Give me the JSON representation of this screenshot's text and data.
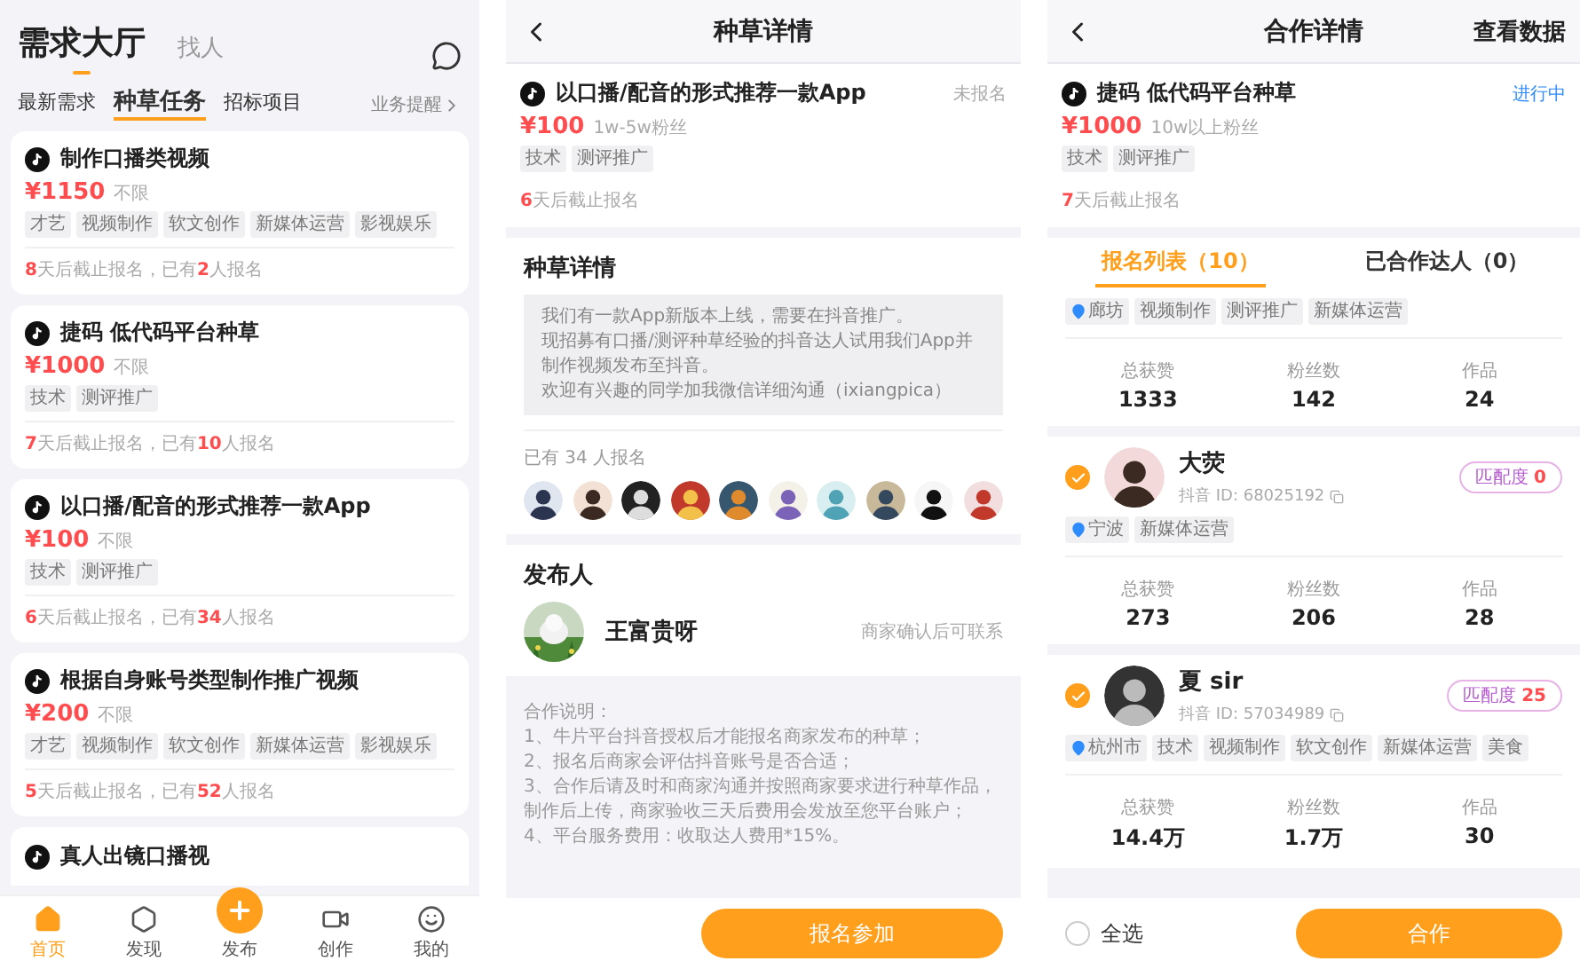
{
  "hall_screen": {
    "header_tabs": [
      {
        "label": "需求大厅",
        "selected": true
      },
      {
        "label": "找人",
        "selected": false
      }
    ],
    "sub_tabs": [
      {
        "label": "最新需求",
        "selected": false
      },
      {
        "label": "种草任务",
        "selected": true
      },
      {
        "label": "招标项目",
        "selected": false
      }
    ],
    "reminder_link": "业务提醒",
    "tasks": [
      {
        "title": "制作口播类视频",
        "price": "¥1150",
        "audience": "不限",
        "tags": [
          "才艺",
          "视频制作",
          "软文创作",
          "新媒体运营",
          "影视娱乐"
        ],
        "footer": [
          {
            "text": "8",
            "highlight": true
          },
          {
            "text": "天后截止报名，已有",
            "highlight": false
          },
          {
            "text": "2",
            "highlight": true
          },
          {
            "text": "人报名",
            "highlight": false
          }
        ]
      },
      {
        "title": "捷码 低代码平台种草",
        "price": "¥1000",
        "audience": "不限",
        "tags": [
          "技术",
          "测评推广"
        ],
        "footer": [
          {
            "text": "7",
            "highlight": true
          },
          {
            "text": "天后截止报名，已有",
            "highlight": false
          },
          {
            "text": "10",
            "highlight": true
          },
          {
            "text": "人报名",
            "highlight": false
          }
        ]
      },
      {
        "title": "以口播/配音的形式推荐一款App",
        "price": "¥100",
        "audience": "不限",
        "tags": [
          "技术",
          "测评推广"
        ],
        "footer": [
          {
            "text": "6",
            "highlight": true
          },
          {
            "text": "天后截止报名，已有",
            "highlight": false
          },
          {
            "text": "34",
            "highlight": true
          },
          {
            "text": "人报名",
            "highlight": false
          }
        ]
      },
      {
        "title": "根据自身账号类型制作推广视频",
        "price": "¥200",
        "audience": "不限",
        "tags": [
          "才艺",
          "视频制作",
          "软文创作",
          "新媒体运营",
          "影视娱乐"
        ],
        "footer": [
          {
            "text": "5",
            "highlight": true
          },
          {
            "text": "天后截止报名，已有",
            "highlight": false
          },
          {
            "text": "52",
            "highlight": true
          },
          {
            "text": "人报名",
            "highlight": false
          }
        ]
      }
    ],
    "partial_task": {
      "title": "真人出镜口播视"
    },
    "nav": [
      {
        "label": "首页",
        "kind": "home",
        "selected": true
      },
      {
        "label": "发现",
        "kind": "discover",
        "selected": false
      },
      {
        "label": "发布",
        "kind": "publish",
        "selected": false
      },
      {
        "label": "创作",
        "kind": "create",
        "selected": false
      },
      {
        "label": "我的",
        "kind": "me",
        "selected": false
      }
    ]
  },
  "detail_screen": {
    "title": "种草详情",
    "task": {
      "title": "以口播/配音的形式推荐一款App",
      "status": {
        "text": "未报名",
        "kind": "pending"
      },
      "price": "¥100",
      "audience": "1w-5w粉丝",
      "tags": [
        "技术",
        "测评推广"
      ],
      "deadline": [
        {
          "text": "6",
          "highlight": true
        },
        {
          "text": "天后截止报名",
          "highlight": false
        }
      ]
    },
    "description": {
      "heading": "种草详情",
      "lines": [
        "我们有一款App新版本上线，需要在抖音推广。",
        "现招募有口播/测评种草经验的抖音达人试用我们App并",
        "制作视频发布至抖音。",
        "欢迎有兴趣的同学加我微信详细沟通（ixiangpica）"
      ]
    },
    "signup_count": "已有 34 人报名",
    "avatars": [
      {
        "kind": "avatar"
      },
      {
        "kind": "avatar"
      },
      {
        "kind": "avatar"
      },
      {
        "kind": "avatar"
      },
      {
        "kind": "avatar"
      },
      {
        "kind": "avatar"
      },
      {
        "kind": "avatar"
      },
      {
        "kind": "avatar"
      },
      {
        "kind": "avatar"
      },
      {
        "kind": "avatar"
      }
    ],
    "publisher": {
      "heading": "发布人",
      "name": "王富贵呀",
      "note": "商家确认后可联系"
    },
    "notes": [
      "合作说明：",
      "1、牛片平台抖音授权后才能报名商家发布的种草；",
      "2、报名后商家会评估抖音账号是否合适；",
      "3、合作后请及时和商家沟通并按照商家要求进行种草作品，制作后上传，商家验收三天后费用会发放至您平台账户；",
      "4、平台服务费用：收取达人费用*15%。"
    ],
    "join_button": "报名参加"
  },
  "cooperation_screen": {
    "title": "合作详情",
    "action": "查看数据",
    "task": {
      "title": "捷码 低代码平台种草",
      "status": {
        "text": "进行中",
        "kind": "active"
      },
      "price": "¥1000",
      "audience": "10w以上粉丝",
      "tags": [
        "技术",
        "测评推广"
      ],
      "deadline": [
        {
          "text": "7",
          "highlight": true
        },
        {
          "text": "天后截止报名",
          "highlight": false
        }
      ]
    },
    "tabs": [
      {
        "label": "报名列表（10）",
        "selected": true
      },
      {
        "label": "已合作达人（0）",
        "selected": false
      }
    ],
    "partial_creator": {
      "tags": [
        {
          "text": "廊坊",
          "kind": "location"
        },
        {
          "text": "视频制作",
          "kind": "tag"
        },
        {
          "text": "测评推广",
          "kind": "tag"
        },
        {
          "text": "新媒体运营",
          "kind": "tag"
        }
      ],
      "stats": [
        {
          "label": "总获赞",
          "value": "1333"
        },
        {
          "label": "粉丝数",
          "value": "142"
        },
        {
          "label": "作品",
          "value": "24"
        }
      ]
    },
    "creators": [
      {
        "name": "大荧",
        "checked": true,
        "douyin_id": "抖音 ID: 68025192",
        "match_label": "匹配度",
        "match_value": "0",
        "tags": [
          {
            "text": "宁波",
            "kind": "location"
          },
          {
            "text": "新媒体运营",
            "kind": "tag"
          }
        ],
        "stats": [
          {
            "label": "总获赞",
            "value": "273"
          },
          {
            "label": "粉丝数",
            "value": "206"
          },
          {
            "label": "作品",
            "value": "28"
          }
        ]
      },
      {
        "name": "夏 sir",
        "checked": true,
        "douyin_id": "抖音 ID: 57034989",
        "match_label": "匹配度",
        "match_value": "25",
        "tags": [
          {
            "text": "杭州市",
            "kind": "location"
          },
          {
            "text": "技术",
            "kind": "tag"
          },
          {
            "text": "视频制作",
            "kind": "tag"
          },
          {
            "text": "软文创作",
            "kind": "tag"
          },
          {
            "text": "新媒体运营",
            "kind": "tag"
          },
          {
            "text": "美食",
            "kind": "tag"
          }
        ],
        "stats": [
          {
            "label": "总获赞",
            "value": "14.4万"
          },
          {
            "label": "粉丝数",
            "value": "1.7万"
          },
          {
            "label": "作品",
            "value": "30"
          }
        ]
      }
    ],
    "select_all": {
      "label": "全选",
      "checked": false
    },
    "confirm_button": "合作"
  }
}
